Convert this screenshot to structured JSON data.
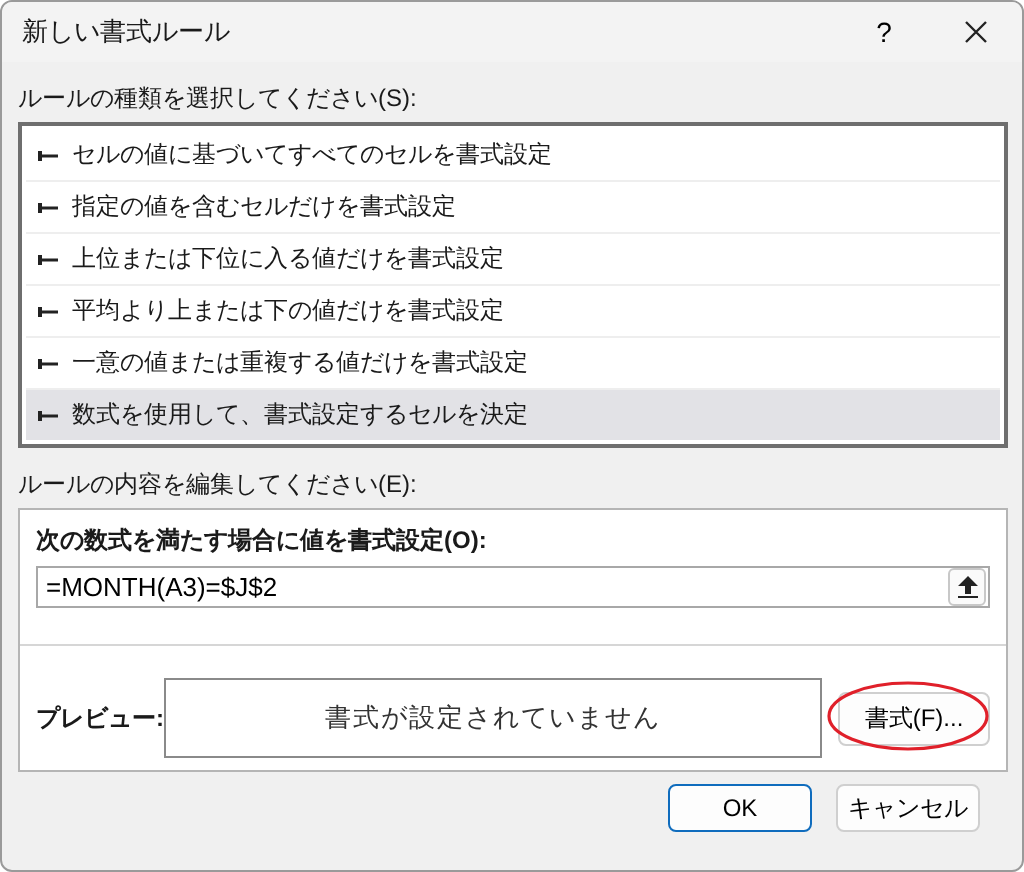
{
  "window": {
    "title": "新しい書式ルール",
    "help": "?"
  },
  "rule_type": {
    "label": "ルールの種類を選択してください(S):",
    "items": [
      {
        "text": "セルの値に基づいてすべてのセルを書式設定",
        "selected": false
      },
      {
        "text": "指定の値を含むセルだけを書式設定",
        "selected": false
      },
      {
        "text": "上位または下位に入る値だけを書式設定",
        "selected": false
      },
      {
        "text": "平均より上または下の値だけを書式設定",
        "selected": false
      },
      {
        "text": "一意の値または重複する値だけを書式設定",
        "selected": false
      },
      {
        "text": "数式を使用して、書式設定するセルを決定",
        "selected": true
      }
    ]
  },
  "rule_edit": {
    "label": "ルールの内容を編集してください(E):",
    "formula_label": "次の数式を満たす場合に値を書式設定(O):",
    "formula": "=MONTH(A3)=$J$2",
    "preview_label": "プレビュー:",
    "preview_text": "書式が設定されていません",
    "format_button": {
      "label": "書式(F)...",
      "highlighted": true
    }
  },
  "buttons": [
    {
      "label": "OK",
      "default": true
    },
    {
      "label": "キャンセル",
      "default": false
    }
  ]
}
